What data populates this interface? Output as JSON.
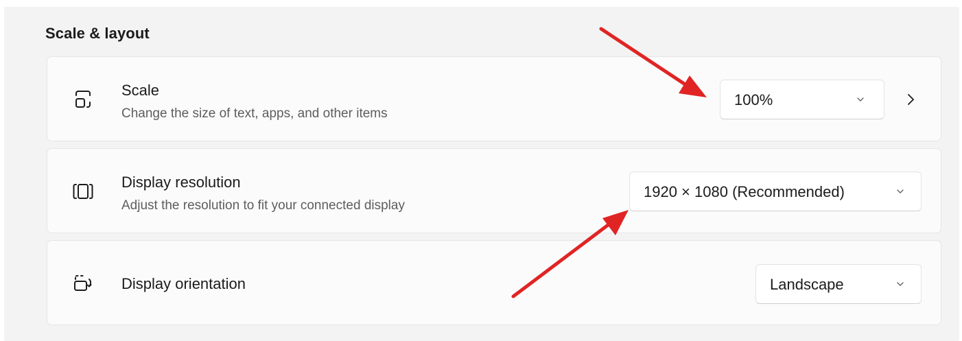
{
  "section": {
    "title": "Scale & layout"
  },
  "scale": {
    "icon": "scale-icon",
    "title": "Scale",
    "description": "Change the size of text, apps, and other items",
    "value": "100%"
  },
  "resolution": {
    "icon": "display-resolution-icon",
    "title": "Display resolution",
    "description": "Adjust the resolution to fit your connected display",
    "value": "1920 × 1080 (Recommended)"
  },
  "orientation": {
    "icon": "display-orientation-icon",
    "title": "Display orientation",
    "value": "Landscape"
  },
  "colors": {
    "background": "#f3f3f3",
    "card": "#fbfbfb",
    "annotation_arrow": "#e02424"
  }
}
